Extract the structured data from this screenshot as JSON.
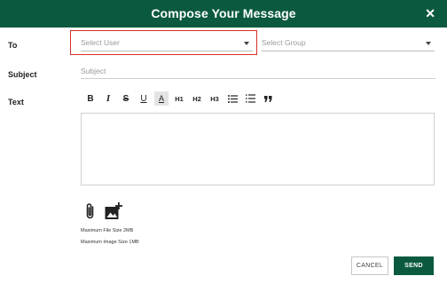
{
  "dialog": {
    "title": "Compose Your Message",
    "close_glyph": "✕"
  },
  "form": {
    "to_label": "To",
    "subject_label": "Subject",
    "text_label": "Text",
    "user_select_placeholder": "Select User",
    "group_select_placeholder": "Select Group",
    "subject_placeholder": "Subject"
  },
  "toolbar": {
    "bold": "B",
    "italic": "I",
    "strike": "S",
    "underline": "U",
    "highlight": "A",
    "h1": "H1",
    "h2": "H2",
    "h3": "H3"
  },
  "attachments": {
    "max_file_size": "Maximum File Size 2MB",
    "max_image_size": "Maximum Image Size 1MB"
  },
  "actions": {
    "cancel_label": "CANCEL",
    "send_label": "SEND"
  },
  "colors": {
    "primary": "#0b5a3f",
    "highlight_border": "#d9302b"
  }
}
